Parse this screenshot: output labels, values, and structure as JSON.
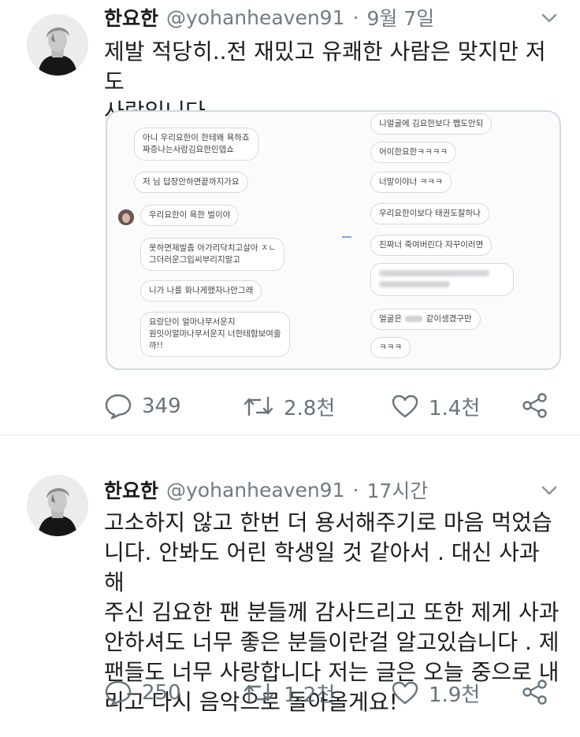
{
  "tweets": [
    {
      "name": "한요한",
      "handle": "@yohanheaven91",
      "separator": "·",
      "time": "9월 7일",
      "text_lines": [
        "제발 적당히..전 재밌고 유쾌한 사람은 맞지만 저도",
        "사람입니다..."
      ],
      "media": {
        "left_messages": [
          "아니 우리요한이 한테왜 욕하죠",
          "짜증나는사람김요한인뎁쇼",
          "저 님 답장안하면끝까지가요",
          "우리요한이 욕한 벌이야",
          "못하면제발좀 아가리닥치고살아 ㅈㄴ",
          "그더러운그입씨부리지말고",
          "니가 나를 화나게했자나안그래",
          "요랑단이 얼마나무서운지",
          "원잇이얼마나무서운지 너한테함보여줄",
          "까!!"
        ],
        "right_messages": [
          "니얼굴에 김요한보다 쨉도안되",
          "어이한요한ㅋㅋㅋㅋ",
          "너말이야너 ㅋㅋㅋ",
          "우리요한이보다 태권도잘하나",
          "진짜너 죽여버린다 자꾸이러면",
          "얼굴은",
          "같이생겼구만",
          "ㅋㅋㅋ"
        ]
      },
      "actions": {
        "replies": "349",
        "retweets": "2.8천",
        "likes": "1.4천"
      }
    },
    {
      "name": "한요한",
      "handle": "@yohanheaven91",
      "separator": "·",
      "time": "17시간",
      "text_lines": [
        "고소하지 않고 한번 더 용서해주기로 마음 먹었습",
        "니다. 안봐도 어린 학생일 것 같아서 . 대신 사과 해",
        "주신 김요한 팬 분들께 감사드리고 또한 제게 사과",
        "안하셔도 너무 좋은 분들이란걸 알고있습니다 . 제",
        "팬들도 너무 사랑합니다 저는 글은 오늘 중으로 내",
        "리고 다시 음악으로 돌아올게요!"
      ],
      "actions": {
        "replies": "250",
        "retweets": "1.2천",
        "likes": "1.9천"
      }
    }
  ],
  "icons": {
    "reply": "reply-icon",
    "retweet": "retweet-icon",
    "like": "like-icon",
    "share": "share-icon",
    "caret": "chevron-down-icon"
  },
  "colors": {
    "name": "#1a1a1a",
    "meta": "#707b83",
    "action": "#68747c",
    "media_border": "#cfd9e5"
  }
}
